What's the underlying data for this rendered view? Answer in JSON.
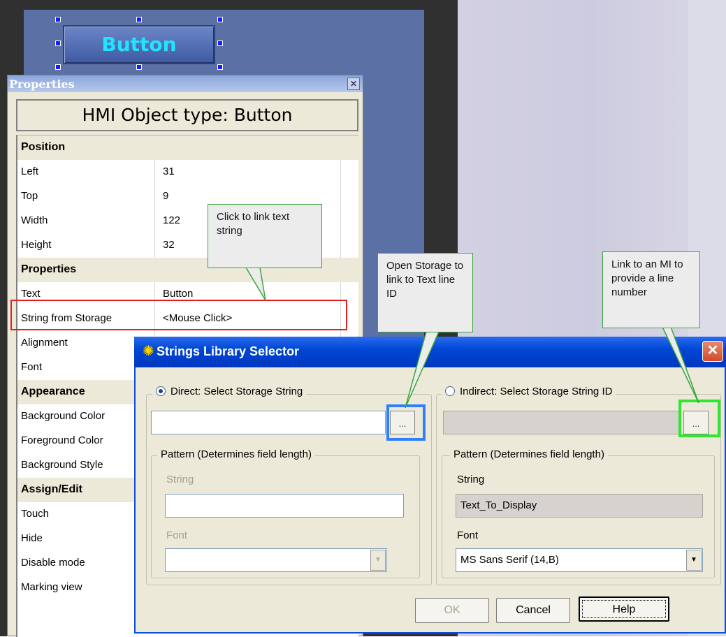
{
  "hmi_button": {
    "label": "Button"
  },
  "properties": {
    "title": "Properties",
    "close_glyph": "✕",
    "header": "HMI Object type: Button",
    "rows": [
      {
        "key": "Position",
        "value": "",
        "category": true
      },
      {
        "key": "Left",
        "value": "31"
      },
      {
        "key": "Top",
        "value": "9"
      },
      {
        "key": "Width",
        "value": "122"
      },
      {
        "key": "Height",
        "value": "32"
      },
      {
        "key": "Properties",
        "value": "",
        "category": true
      },
      {
        "key": "Text",
        "value": "Button"
      },
      {
        "key": "String from Storage",
        "value": "<Mouse Click>"
      },
      {
        "key": "Alignment",
        "value": ""
      },
      {
        "key": "Font",
        "value": ""
      },
      {
        "key": "Appearance",
        "value": "",
        "category": true
      },
      {
        "key": "Background Color",
        "value": ""
      },
      {
        "key": "Foreground Color",
        "value": ""
      },
      {
        "key": "Background Style",
        "value": ""
      },
      {
        "key": "Assign/Edit",
        "value": "",
        "category": true
      },
      {
        "key": "Touch",
        "value": ""
      },
      {
        "key": "Hide",
        "value": ""
      },
      {
        "key": "Disable mode",
        "value": ""
      },
      {
        "key": "Marking view",
        "value": ""
      }
    ]
  },
  "callouts": {
    "link_text": "Click to link text string",
    "open_storage": "Open Storage to link to Text line ID",
    "link_mi": "Link to an MI to provide a line number"
  },
  "dialog": {
    "title": "Strings Library  Selector",
    "close_glyph": "✕",
    "direct": {
      "radio_label": "Direct: Select Storage String",
      "selected": true,
      "value": "",
      "browse_label": "...",
      "pattern_legend": "Pattern (Determines field length)",
      "string_label": "String",
      "string_value": "",
      "font_label": "Font",
      "font_value": ""
    },
    "indirect": {
      "radio_label": "Indirect: Select Storage String ID",
      "selected": false,
      "value": "",
      "browse_label": "...",
      "pattern_legend": "Pattern (Determines field length)",
      "string_label": "String",
      "string_value": "Text_To_Display",
      "font_label": "Font",
      "font_value": "MS Sans Serif (14,B)"
    },
    "buttons": {
      "ok": "OK",
      "cancel": "Cancel",
      "help": "Help"
    }
  },
  "colors": {
    "canvas": "#5b71a6",
    "button_text": "#22e4ff",
    "dialog_title": "#0047d4",
    "highlight_red": "#e02020",
    "highlight_blue": "#2f7fff",
    "highlight_green": "#2ee82e",
    "callout_border": "#3aa63a"
  }
}
